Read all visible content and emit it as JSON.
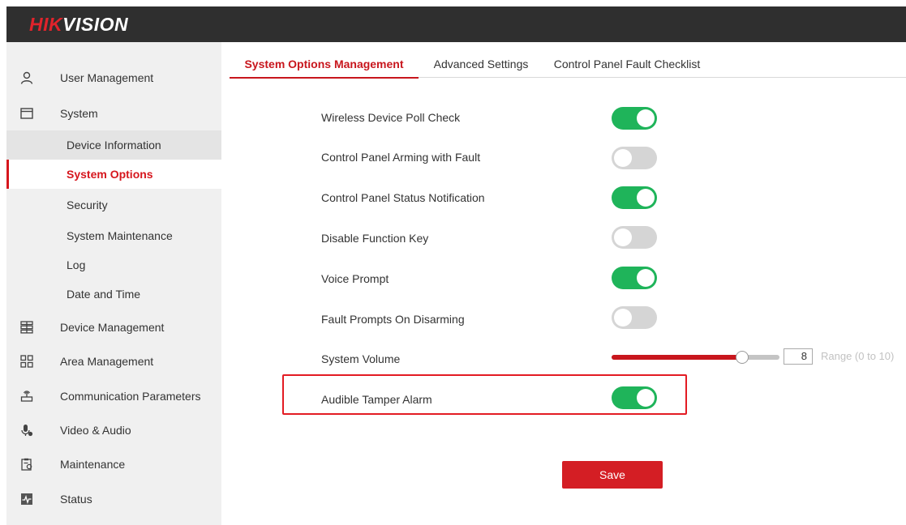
{
  "brand": {
    "part_a": "HIK",
    "part_b": "VISION"
  },
  "sidebar": {
    "items": [
      {
        "label": "User Management",
        "icon": "user-icon"
      },
      {
        "label": "System",
        "icon": "window-icon"
      },
      {
        "label": "Device Management",
        "icon": "device-grid-icon"
      },
      {
        "label": "Area Management",
        "icon": "area-grid-icon"
      },
      {
        "label": "Communication Parameters",
        "icon": "router-icon"
      },
      {
        "label": "Video & Audio",
        "icon": "mic-icon"
      },
      {
        "label": "Maintenance",
        "icon": "clipboard-gear-icon"
      },
      {
        "label": "Status",
        "icon": "pulse-icon"
      }
    ],
    "system_children": [
      {
        "label": "Device Information"
      },
      {
        "label": "System Options"
      },
      {
        "label": "Security"
      },
      {
        "label": "System Maintenance"
      },
      {
        "label": "Log"
      },
      {
        "label": "Date and Time"
      }
    ]
  },
  "tabs": [
    {
      "label": "System Options Management",
      "active": true
    },
    {
      "label": "Advanced Settings",
      "active": false
    },
    {
      "label": "Control Panel Fault Checklist",
      "active": false
    }
  ],
  "options": [
    {
      "label": "Wireless Device Poll Check",
      "enabled": true
    },
    {
      "label": "Control Panel Arming with Fault",
      "enabled": false
    },
    {
      "label": "Control Panel Status Notification",
      "enabled": true
    },
    {
      "label": "Disable Function Key",
      "enabled": false
    },
    {
      "label": "Voice Prompt",
      "enabled": true
    },
    {
      "label": "Fault Prompts On Disarming",
      "enabled": false
    }
  ],
  "volume": {
    "label": "System Volume",
    "value": "8",
    "min": 0,
    "max": 10,
    "range_note": "Range (0 to 10)"
  },
  "tamper": {
    "label": "Audible Tamper Alarm",
    "enabled": true
  },
  "save_label": "Save",
  "colors": {
    "accent_red": "#d6161d",
    "toggle_on": "#1fb45a",
    "toggle_off": "#d5d5d5",
    "topbar": "#2f2f2f"
  }
}
